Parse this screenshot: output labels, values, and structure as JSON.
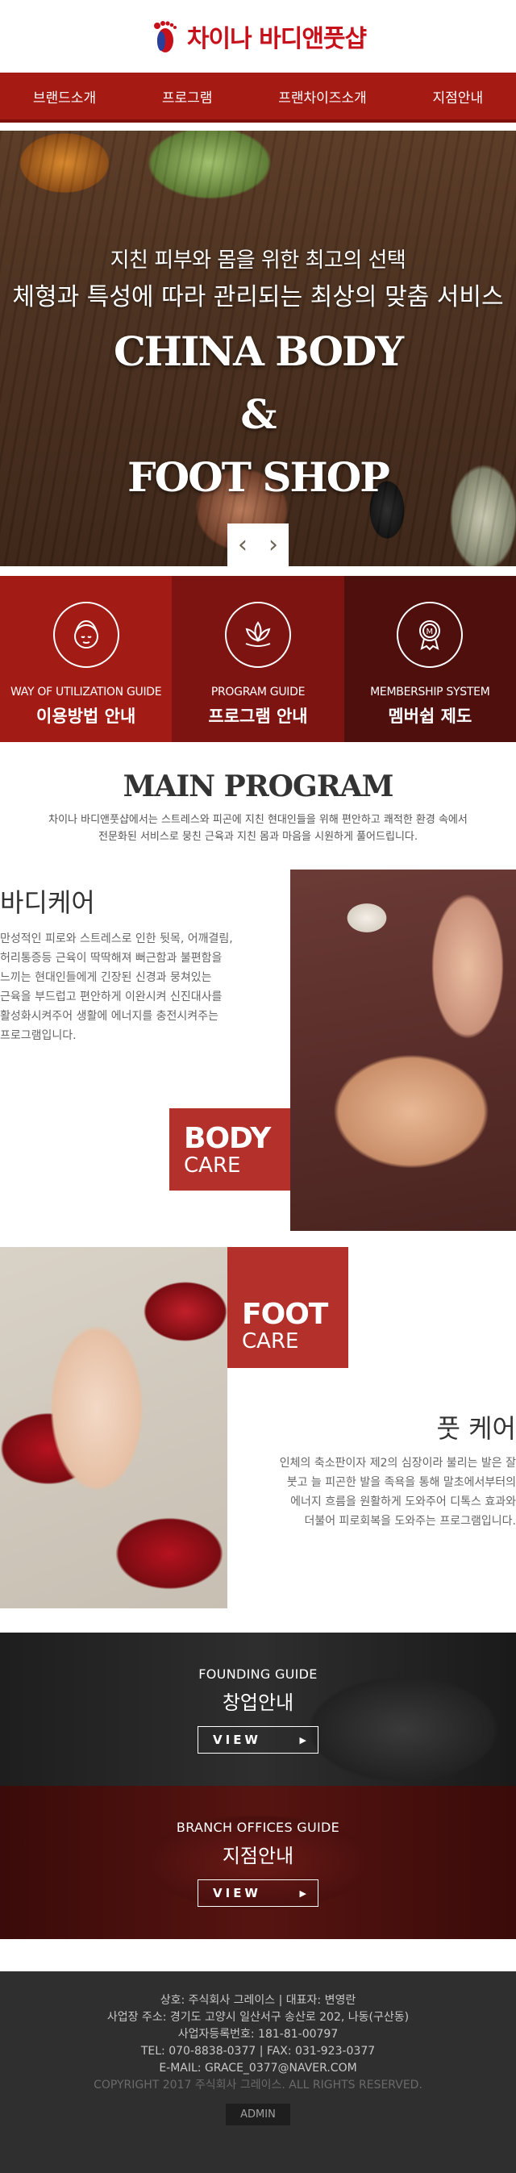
{
  "header": {
    "logo_text": "차이나 바디앤풋샵",
    "logo_icon": "foot-logo-icon",
    "brand_color": "#c8101a"
  },
  "nav": {
    "items": [
      {
        "label": "브랜드소개"
      },
      {
        "label": "프로그램"
      },
      {
        "label": "프랜차이즈소개"
      },
      {
        "label": "지점안내"
      }
    ],
    "color": "#a51b14"
  },
  "hero": {
    "subtitle_1": "지친 피부와 몸을 위한 최고의 선택",
    "subtitle_2": "체형과 특성에 따라 관리되는 최상의 맞춤 서비스",
    "title_1": "CHINA BODY",
    "title_2": "&",
    "title_3": "FOOT SHOP",
    "prev_icon": "chevron-left-icon",
    "next_icon": "chevron-right-icon"
  },
  "guides": [
    {
      "en": "WAY OF UTILIZATION GUIDE",
      "ko": "이용방법 안내",
      "icon": "face-icon",
      "color": "#a21b14"
    },
    {
      "en": "PROGRAM GUIDE",
      "ko": "프로그램 안내",
      "icon": "lotus-icon",
      "color": "#7d1411"
    },
    {
      "en": "MEMBERSHIP SYSTEM",
      "ko": "멤버쉽 제도",
      "icon": "membership-medal-icon",
      "color": "#4e0f0d"
    }
  ],
  "main_program": {
    "title": "MAIN PROGRAM",
    "desc_1": "차이나 바디앤풋샵에서는 스트레스와 피곤에 지친 현대인들을 위해 편안하고 쾌적한 환경 속에서",
    "desc_2": "전문화된 서비스로 뭉친 근육과 지친 몸과 마음을 시원하게 풀어드립니다."
  },
  "body_care": {
    "title": "바디케어",
    "text": [
      "만성적인 피로와 스트레스로 인한 뒷목, 어깨결림,",
      "허리통증등 근육이 딱딱해져 뻐근함과 불편함을",
      "느끼는 현대인들에게 긴장된 신경과 뭉쳐있는",
      "근육을 부드럽고 편안하게 이완시켜 신진대사를",
      "활성화시켜주어 생활에 에너지를 충전시켜주는",
      "프로그램입니다."
    ],
    "badge_big": "BODY",
    "badge_small": "CARE"
  },
  "foot_care": {
    "title": "풋 케어",
    "text": [
      "인체의 축소판이자 제2의 심장이라 불리는 발은 잘",
      "붓고 늘 피곤한 발을 족욕을 통해 말초에서부터의",
      "에너지 흐름을 원활하게 도와주어 디톡스 효과와",
      "더불어 피로회복을 도와주는 프로그램입니다."
    ],
    "badge_big": "FOOT",
    "badge_small": "CARE"
  },
  "banners": [
    {
      "en": "FOUNDING GUIDE",
      "ko": "창업안내",
      "button": "VIEW"
    },
    {
      "en": "BRANCH OFFICES GUIDE",
      "ko": "지점안내",
      "button": "VIEW"
    }
  ],
  "footer": {
    "lines": [
      "상호: 주식회사 그레이스  |  대표자: 변영란",
      "사업장 주소: 경기도 고양시 일산서구 송산로 202, 나동(구산동)",
      "사업자등록번호: 181-81-00797",
      "TEL: 070-8838-0377  |  FAX: 031-923-0377",
      "E-MAIL: GRACE_0377@NAVER.COM"
    ],
    "copyright": "COPYRIGHT 2017 주식회사 그레이스. ALL RIGHTS RESERVED.",
    "admin": "ADMIN"
  }
}
